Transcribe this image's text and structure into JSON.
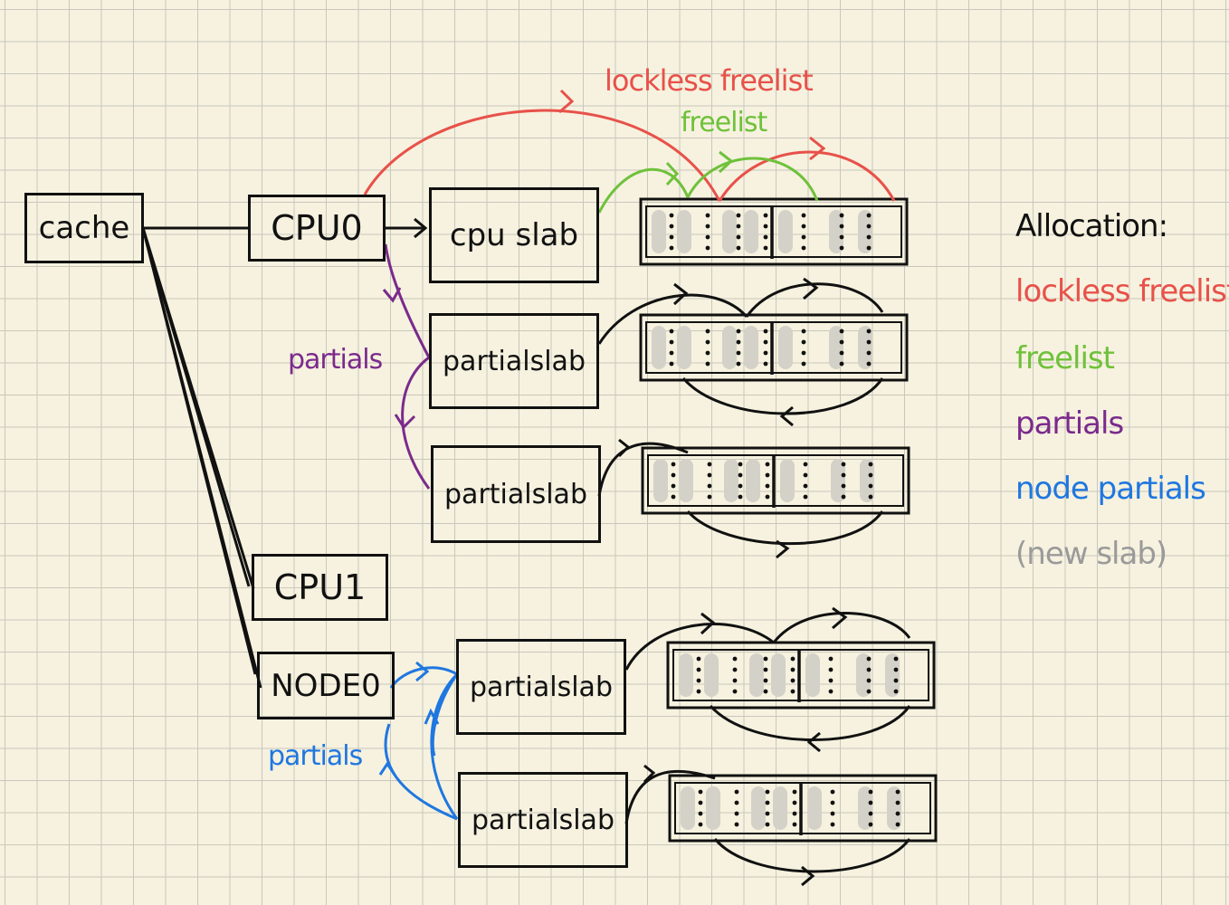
{
  "colors": {
    "lockless": "#e8514a",
    "freelist": "#6fc13b",
    "partials": "#7b2a8c",
    "node_partials": "#1f77e0",
    "new_slab": "#9a9a9a",
    "ink": "#111111"
  },
  "nodes": {
    "cache": "cache",
    "cpu0": "CPU0",
    "cpu1": "CPU1",
    "node0": "NODE0",
    "cpu_slab": "cpu slab",
    "partial_slab": "partialslab"
  },
  "labels": {
    "lockless_freelist": "lockless freelist",
    "freelist": "freelist",
    "partials_cpu": "partials",
    "partials_node": "partials"
  },
  "legend": {
    "title": "Allocation:",
    "items": [
      {
        "text": "lockless freelist",
        "color": "#e8514a"
      },
      {
        "text": "freelist",
        "color": "#6fc13b"
      },
      {
        "text": "partials",
        "color": "#7b2a8c"
      },
      {
        "text": "node partials",
        "color": "#1f77e0"
      },
      {
        "text": "(new slab)",
        "color": "#9a9a9a"
      }
    ]
  }
}
